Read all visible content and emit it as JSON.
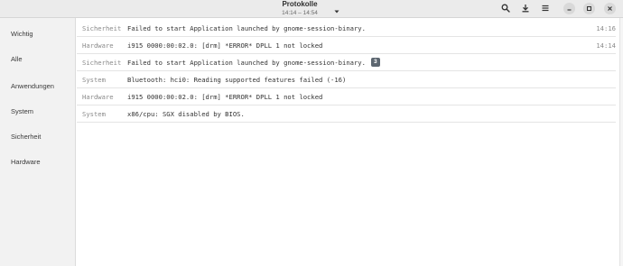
{
  "header": {
    "title": "Protokolle",
    "time_range": "14:14 – 14:54",
    "icons": {
      "menu": "chevron-down-icon",
      "search": "search-icon",
      "export": "download-icon",
      "options": "hamburger-menu-icon",
      "minimize": "minimize-icon",
      "maximize": "maximize-icon",
      "close": "close-icon"
    }
  },
  "sidebar": {
    "items": [
      {
        "label": "Wichtig"
      },
      {
        "label": "Alle"
      },
      {
        "label": "Anwendungen"
      },
      {
        "label": "System"
      },
      {
        "label": "Sicherheit"
      },
      {
        "label": "Hardware"
      }
    ]
  },
  "logs": [
    {
      "category": "Sicherheit",
      "message": "Failed to start Application launched by gnome-session-binary.",
      "time": "14:16",
      "count": ""
    },
    {
      "category": "Hardware",
      "message": "i915 0000:00:02.0: [drm] *ERROR* DPLL 1 not locked",
      "time": "14:14",
      "count": ""
    },
    {
      "category": "Sicherheit",
      "message": "Failed to start Application launched by gnome-session-binary.",
      "time": "",
      "count": "3"
    },
    {
      "category": "System",
      "message": "Bluetooth: hci0: Reading supported features failed (-16)",
      "time": "",
      "count": ""
    },
    {
      "category": "Hardware",
      "message": "i915 0000:00:02.0: [drm] *ERROR* DPLL 1 not locked",
      "time": "",
      "count": ""
    },
    {
      "category": "System",
      "message": "x86/cpu: SGX disabled by BIOS.",
      "time": "",
      "count": ""
    }
  ],
  "colors": {
    "headerbar": "#ebebeb",
    "sidebar": "#f2f2f2",
    "badge": "#5c6670"
  }
}
